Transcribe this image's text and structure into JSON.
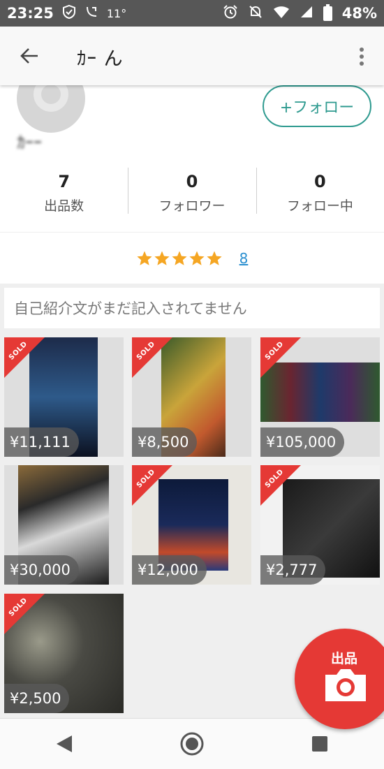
{
  "status_bar": {
    "time": "23:25",
    "temperature": "11°",
    "battery": "48%"
  },
  "header": {
    "title": "ｶｰ ん",
    "back_icon": "arrow-left-icon",
    "menu_icon": "more-vert-icon"
  },
  "profile": {
    "name": "ｶｰｰ",
    "follow_button": "+フォロー",
    "stats": [
      {
        "value": "7",
        "label": "出品数"
      },
      {
        "value": "0",
        "label": "フォロワー"
      },
      {
        "value": "0",
        "label": "フォロー中"
      }
    ]
  },
  "rating": {
    "stars": 5,
    "count": "8",
    "star_color": "#f5a623"
  },
  "intro": {
    "text": "自己紹介文がまだ記入されてません"
  },
  "items": [
    {
      "price": "¥11,111",
      "sold_label": "SOLD"
    },
    {
      "price": "¥8,500",
      "sold_label": "SOLD"
    },
    {
      "price": "¥105,000",
      "sold_label": "SOLD"
    },
    {
      "price": "¥30,000",
      "sold_label": ""
    },
    {
      "price": "¥12,000",
      "sold_label": "SOLD"
    },
    {
      "price": "¥2,777",
      "sold_label": "SOLD"
    },
    {
      "price": "¥2,500",
      "sold_label": "SOLD"
    }
  ],
  "sell_button": {
    "label": "出品",
    "icon": "camera-icon",
    "color": "#e53935"
  },
  "colors": {
    "accent": "#2e9a8f",
    "sold": "#e53935",
    "link": "#2a8fd0"
  }
}
